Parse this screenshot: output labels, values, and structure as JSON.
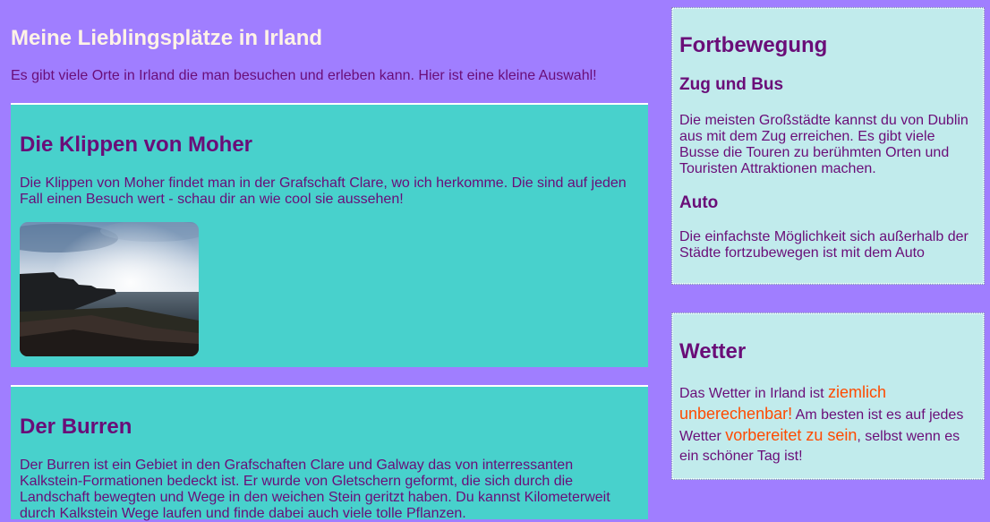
{
  "page": {
    "title": "Meine Lieblingsplätze in Irland",
    "intro": "Es gibt viele Orte in Irland die man besuchen und erleben kann. Hier ist eine kleine Auswahl!"
  },
  "articles": [
    {
      "heading": "Die Klippen von Moher",
      "text": "Die Klippen von Moher findet man in der Grafschaft Clare, wo ich herkomme. Die sind auf jeden Fall einen Besuch wert - schau dir an wie cool sie aussehen!",
      "image": "cliffs-photo"
    },
    {
      "heading": "Der Burren",
      "text": "Der Burren ist ein Gebiet in den Grafschaften Clare und Galway das von interressanten Kalkstein-Formationen bedeckt ist. Er wurde von Gletschern geformt, die sich durch die Landschaft bewegten und Wege in den weichen Stein geritzt haben. Du kannst Kilometerweit durch Kalkstein Wege laufen und finde dabei auch viele tolle Pflanzen."
    }
  ],
  "aside": {
    "transport": {
      "heading": "Fortbewegung",
      "sub1": "Zug und Bus",
      "text1": "Die meisten Großstädte kannst du von Dublin aus mit dem Zug erreichen. Es gibt viele Busse die Touren zu berühmten Orten und Touristen Attraktionen machen.",
      "sub2": "Auto",
      "text2": "Die einfachste Möglichkeit sich außerhalb der Städte fortzubewegen ist mit dem Auto"
    },
    "weather": {
      "heading": "Wetter",
      "part1": "Das Wetter in Irland ist ",
      "highlight1": "ziemlich unberechenbar!",
      "part2": " Am besten ist es auf jedes Wetter ",
      "highlight2": "vorbereitet zu sein",
      "part3": ", selbst wenn es ein schöner Tag ist!"
    }
  },
  "colors": {
    "background": "#a07eff",
    "article": "#48d1cc",
    "aside": "#c1ebec",
    "text": "#6a0d78",
    "highlight": "#ff4a00"
  }
}
